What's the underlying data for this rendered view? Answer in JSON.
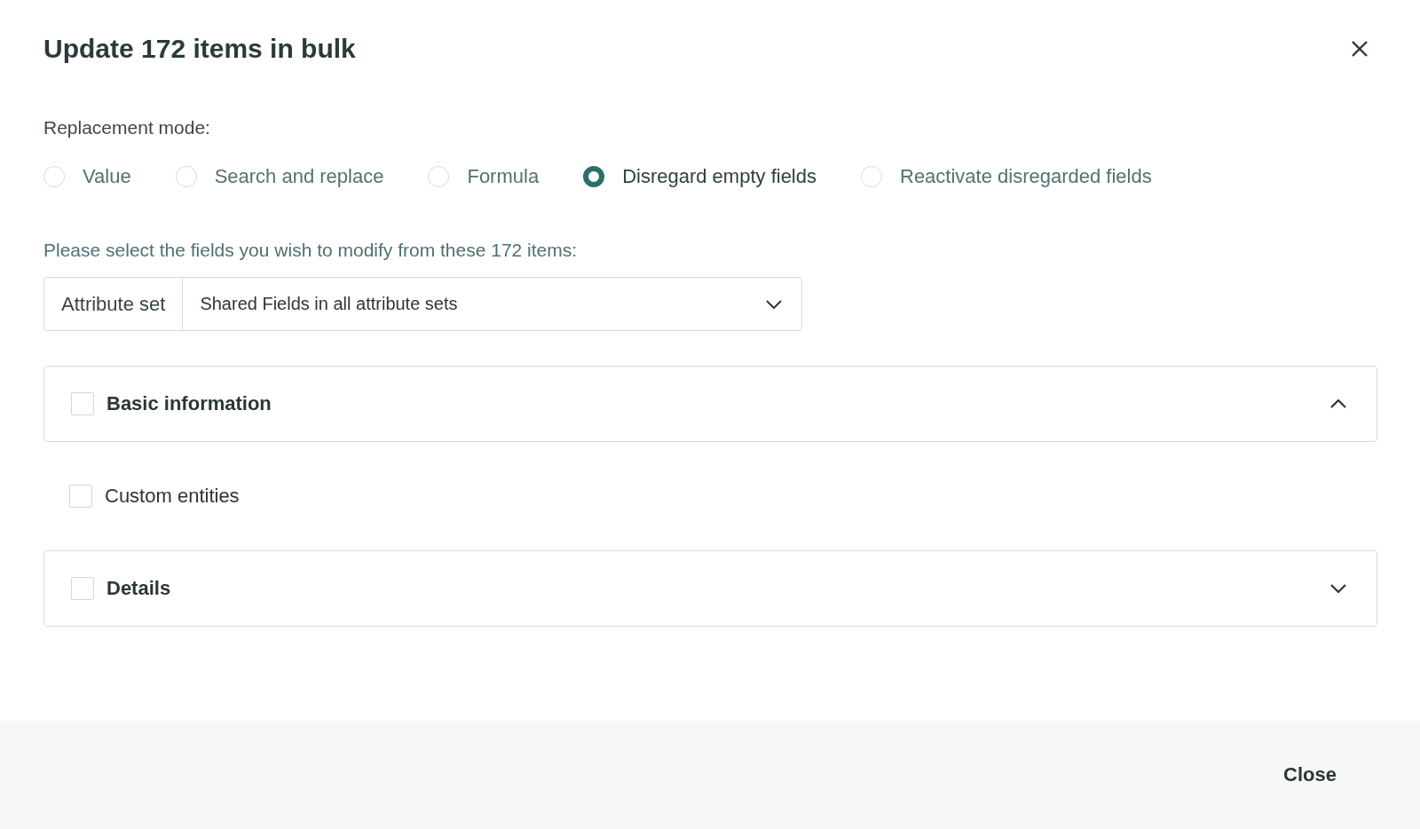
{
  "dialog": {
    "title": "Update 172 items in bulk"
  },
  "replacement_mode": {
    "label": "Replacement mode:",
    "options": [
      {
        "label": "Value",
        "selected": false
      },
      {
        "label": "Search and replace",
        "selected": false
      },
      {
        "label": "Formula",
        "selected": false
      },
      {
        "label": "Disregard empty fields",
        "selected": true
      },
      {
        "label": "Reactivate disregarded fields",
        "selected": false
      }
    ]
  },
  "fields_prompt": "Please select the fields you wish to modify from these 172 items:",
  "attribute_set": {
    "label": "Attribute set",
    "value": "Shared Fields in all attribute sets"
  },
  "sections": [
    {
      "kind": "panel",
      "label": "Basic information",
      "checked": false,
      "expanded": true
    },
    {
      "kind": "plain",
      "label": "Custom entities",
      "checked": false
    },
    {
      "kind": "panel",
      "label": "Details",
      "checked": false,
      "expanded": false
    }
  ],
  "footer": {
    "close_button": "Close"
  }
}
